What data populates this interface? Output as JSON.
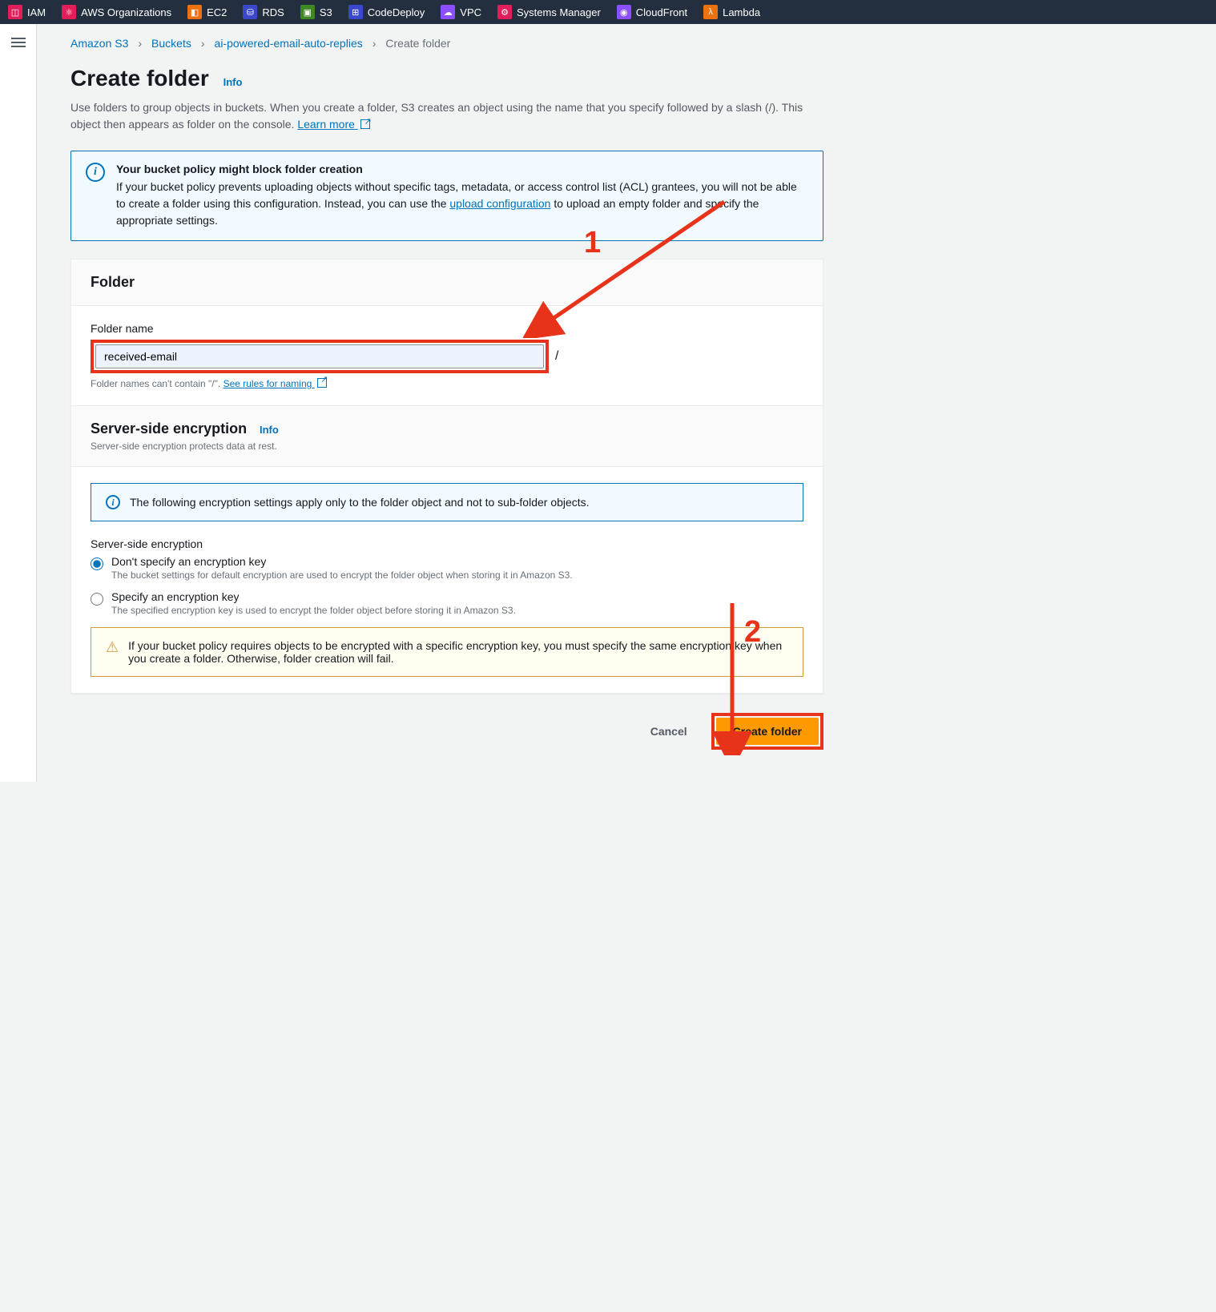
{
  "nav": [
    {
      "label": "IAM",
      "color": "#e01e5a"
    },
    {
      "label": "AWS Organizations",
      "color": "#e01e5a"
    },
    {
      "label": "EC2",
      "color": "#ec7211"
    },
    {
      "label": "RDS",
      "color": "#3b48cc"
    },
    {
      "label": "S3",
      "color": "#3f8624"
    },
    {
      "label": "CodeDeploy",
      "color": "#3b48cc"
    },
    {
      "label": "VPC",
      "color": "#8c4fff"
    },
    {
      "label": "Systems Manager",
      "color": "#e01e5a"
    },
    {
      "label": "CloudFront",
      "color": "#8c4fff"
    },
    {
      "label": "Lambda",
      "color": "#ec7211"
    }
  ],
  "breadcrumb": {
    "items": [
      "Amazon S3",
      "Buckets",
      "ai-powered-email-auto-replies"
    ],
    "current": "Create folder"
  },
  "page": {
    "title": "Create folder",
    "info": "Info",
    "description": "Use folders to group objects in buckets. When you create a folder, S3 creates an object using the name that you specify followed by a slash (/). This object then appears as folder on the console. ",
    "learn_more": "Learn more"
  },
  "policy_alert": {
    "title": "Your bucket policy might block folder creation",
    "body_prefix": "If your bucket policy prevents uploading objects without specific tags, metadata, or access control list (ACL) grantees, you will not be able to create a folder using this configuration. Instead, you can use the ",
    "link": "upload configuration",
    "body_suffix": " to upload an empty folder and specify the appropriate settings."
  },
  "folder": {
    "heading": "Folder",
    "label": "Folder name",
    "value": "received-email",
    "slash": "/",
    "hint_prefix": "Folder names can't contain \"/\". ",
    "hint_link": "See rules for naming"
  },
  "encryption": {
    "heading": "Server-side encryption",
    "info": "Info",
    "sub": "Server-side encryption protects data at rest.",
    "alert": "The following encryption settings apply only to the folder object and not to sub-folder objects.",
    "group_label": "Server-side encryption",
    "options": [
      {
        "label": "Don't specify an encryption key",
        "desc": "The bucket settings for default encryption are used to encrypt the folder object when storing it in Amazon S3."
      },
      {
        "label": "Specify an encryption key",
        "desc": "The specified encryption key is used to encrypt the folder object before storing it in Amazon S3."
      }
    ],
    "warning": "If your bucket policy requires objects to be encrypted with a specific encryption key, you must specify the same encryption key when you create a folder. Otherwise, folder creation will fail."
  },
  "actions": {
    "cancel": "Cancel",
    "create": "Create folder"
  },
  "annotations": {
    "one": "1",
    "two": "2"
  }
}
